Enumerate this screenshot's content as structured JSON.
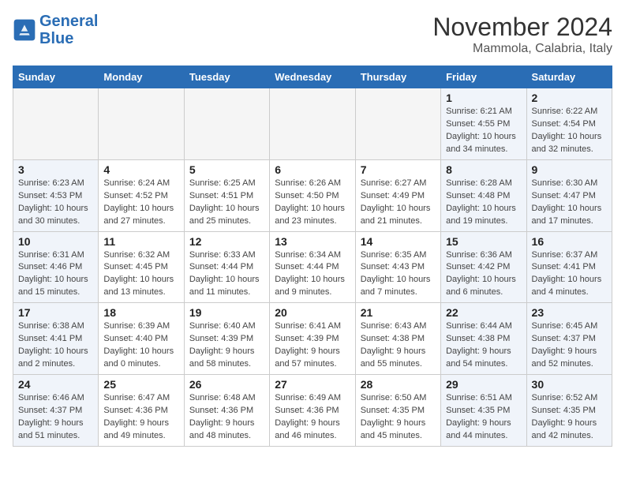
{
  "logo": {
    "line1": "General",
    "line2": "Blue"
  },
  "title": "November 2024",
  "location": "Mammola, Calabria, Italy",
  "weekdays": [
    "Sunday",
    "Monday",
    "Tuesday",
    "Wednesday",
    "Thursday",
    "Friday",
    "Saturday"
  ],
  "weeks": [
    [
      {
        "day": "",
        "info": "",
        "type": "empty"
      },
      {
        "day": "",
        "info": "",
        "type": "empty"
      },
      {
        "day": "",
        "info": "",
        "type": "empty"
      },
      {
        "day": "",
        "info": "",
        "type": "empty"
      },
      {
        "day": "",
        "info": "",
        "type": "empty"
      },
      {
        "day": "1",
        "info": "Sunrise: 6:21 AM\nSunset: 4:55 PM\nDaylight: 10 hours\nand 34 minutes.",
        "type": "weekend"
      },
      {
        "day": "2",
        "info": "Sunrise: 6:22 AM\nSunset: 4:54 PM\nDaylight: 10 hours\nand 32 minutes.",
        "type": "weekend"
      }
    ],
    [
      {
        "day": "3",
        "info": "Sunrise: 6:23 AM\nSunset: 4:53 PM\nDaylight: 10 hours\nand 30 minutes.",
        "type": "weekend"
      },
      {
        "day": "4",
        "info": "Sunrise: 6:24 AM\nSunset: 4:52 PM\nDaylight: 10 hours\nand 27 minutes.",
        "type": "normal"
      },
      {
        "day": "5",
        "info": "Sunrise: 6:25 AM\nSunset: 4:51 PM\nDaylight: 10 hours\nand 25 minutes.",
        "type": "normal"
      },
      {
        "day": "6",
        "info": "Sunrise: 6:26 AM\nSunset: 4:50 PM\nDaylight: 10 hours\nand 23 minutes.",
        "type": "normal"
      },
      {
        "day": "7",
        "info": "Sunrise: 6:27 AM\nSunset: 4:49 PM\nDaylight: 10 hours\nand 21 minutes.",
        "type": "normal"
      },
      {
        "day": "8",
        "info": "Sunrise: 6:28 AM\nSunset: 4:48 PM\nDaylight: 10 hours\nand 19 minutes.",
        "type": "weekend"
      },
      {
        "day": "9",
        "info": "Sunrise: 6:30 AM\nSunset: 4:47 PM\nDaylight: 10 hours\nand 17 minutes.",
        "type": "weekend"
      }
    ],
    [
      {
        "day": "10",
        "info": "Sunrise: 6:31 AM\nSunset: 4:46 PM\nDaylight: 10 hours\nand 15 minutes.",
        "type": "weekend"
      },
      {
        "day": "11",
        "info": "Sunrise: 6:32 AM\nSunset: 4:45 PM\nDaylight: 10 hours\nand 13 minutes.",
        "type": "normal"
      },
      {
        "day": "12",
        "info": "Sunrise: 6:33 AM\nSunset: 4:44 PM\nDaylight: 10 hours\nand 11 minutes.",
        "type": "normal"
      },
      {
        "day": "13",
        "info": "Sunrise: 6:34 AM\nSunset: 4:44 PM\nDaylight: 10 hours\nand 9 minutes.",
        "type": "normal"
      },
      {
        "day": "14",
        "info": "Sunrise: 6:35 AM\nSunset: 4:43 PM\nDaylight: 10 hours\nand 7 minutes.",
        "type": "normal"
      },
      {
        "day": "15",
        "info": "Sunrise: 6:36 AM\nSunset: 4:42 PM\nDaylight: 10 hours\nand 6 minutes.",
        "type": "weekend"
      },
      {
        "day": "16",
        "info": "Sunrise: 6:37 AM\nSunset: 4:41 PM\nDaylight: 10 hours\nand 4 minutes.",
        "type": "weekend"
      }
    ],
    [
      {
        "day": "17",
        "info": "Sunrise: 6:38 AM\nSunset: 4:41 PM\nDaylight: 10 hours\nand 2 minutes.",
        "type": "weekend"
      },
      {
        "day": "18",
        "info": "Sunrise: 6:39 AM\nSunset: 4:40 PM\nDaylight: 10 hours\nand 0 minutes.",
        "type": "normal"
      },
      {
        "day": "19",
        "info": "Sunrise: 6:40 AM\nSunset: 4:39 PM\nDaylight: 9 hours\nand 58 minutes.",
        "type": "normal"
      },
      {
        "day": "20",
        "info": "Sunrise: 6:41 AM\nSunset: 4:39 PM\nDaylight: 9 hours\nand 57 minutes.",
        "type": "normal"
      },
      {
        "day": "21",
        "info": "Sunrise: 6:43 AM\nSunset: 4:38 PM\nDaylight: 9 hours\nand 55 minutes.",
        "type": "normal"
      },
      {
        "day": "22",
        "info": "Sunrise: 6:44 AM\nSunset: 4:38 PM\nDaylight: 9 hours\nand 54 minutes.",
        "type": "weekend"
      },
      {
        "day": "23",
        "info": "Sunrise: 6:45 AM\nSunset: 4:37 PM\nDaylight: 9 hours\nand 52 minutes.",
        "type": "weekend"
      }
    ],
    [
      {
        "day": "24",
        "info": "Sunrise: 6:46 AM\nSunset: 4:37 PM\nDaylight: 9 hours\nand 51 minutes.",
        "type": "weekend"
      },
      {
        "day": "25",
        "info": "Sunrise: 6:47 AM\nSunset: 4:36 PM\nDaylight: 9 hours\nand 49 minutes.",
        "type": "normal"
      },
      {
        "day": "26",
        "info": "Sunrise: 6:48 AM\nSunset: 4:36 PM\nDaylight: 9 hours\nand 48 minutes.",
        "type": "normal"
      },
      {
        "day": "27",
        "info": "Sunrise: 6:49 AM\nSunset: 4:36 PM\nDaylight: 9 hours\nand 46 minutes.",
        "type": "normal"
      },
      {
        "day": "28",
        "info": "Sunrise: 6:50 AM\nSunset: 4:35 PM\nDaylight: 9 hours\nand 45 minutes.",
        "type": "normal"
      },
      {
        "day": "29",
        "info": "Sunrise: 6:51 AM\nSunset: 4:35 PM\nDaylight: 9 hours\nand 44 minutes.",
        "type": "weekend"
      },
      {
        "day": "30",
        "info": "Sunrise: 6:52 AM\nSunset: 4:35 PM\nDaylight: 9 hours\nand 42 minutes.",
        "type": "weekend"
      }
    ]
  ]
}
